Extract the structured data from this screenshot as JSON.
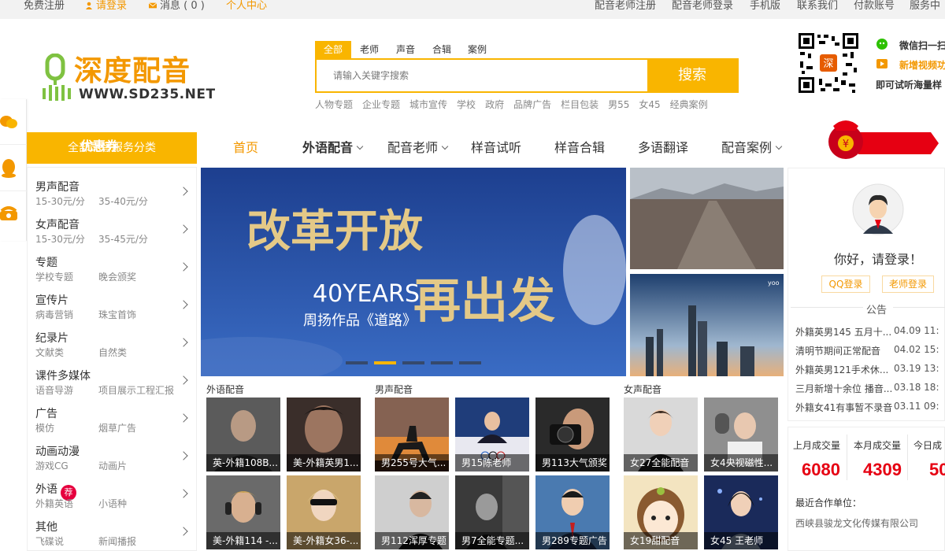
{
  "topbar": {
    "register": "免费注册",
    "login": "请登录",
    "messages": "消息 ( 0 )",
    "personal_center": "个人中心",
    "teacher_register": "配音老师注册",
    "teacher_login": "配音老师登录",
    "mobile": "手机版",
    "contact": "联系我们",
    "payment_account": "付款账号",
    "service": "服务中"
  },
  "logo": {
    "name": "深度配音",
    "url": "WWW.SD235.NET"
  },
  "search": {
    "tabs": [
      "全部",
      "老师",
      "声音",
      "合辑",
      "案例"
    ],
    "placeholder": "请输入关键字搜索",
    "button": "搜索",
    "hotwords": [
      "人物专题",
      "企业专题",
      "城市宣传",
      "学校",
      "政府",
      "品牌广告",
      "栏目包装",
      "男55",
      "女45",
      "经典案例"
    ]
  },
  "promo": {
    "line1": "微信扫一扫",
    "line2": "新增视频功",
    "line3": "即可试听海量样",
    "qr_badge": "深"
  },
  "category_header": "全部配音服务分类",
  "categories": [
    {
      "title": "男声配音",
      "sub1": "15-30元/分",
      "sub2": "35-40元/分"
    },
    {
      "title": "女声配音",
      "sub1": "15-30元/分",
      "sub2": "35-45元/分"
    },
    {
      "title": "专题",
      "sub1": "学校专题",
      "sub2": "晚会颁奖"
    },
    {
      "title": "宣传片",
      "sub1": "病毒营销",
      "sub2": "珠宝首饰"
    },
    {
      "title": "纪录片",
      "sub1": "文献类",
      "sub2": "自然类"
    },
    {
      "title": "课件多媒体",
      "sub1": "语音导游",
      "sub2": "项目展示工程汇报"
    },
    {
      "title": "广告",
      "sub1": "模仿",
      "sub2": "烟草广告"
    },
    {
      "title": "动画动漫",
      "sub1": "游戏CG",
      "sub2": "动画片"
    },
    {
      "title": "外语",
      "sub1": "外籍英语",
      "sub2": "小语种",
      "badge": "荐"
    },
    {
      "title": "其他",
      "sub1": "飞碟说",
      "sub2": "新闻播报"
    }
  ],
  "nav": [
    "首页",
    "外语配音",
    "配音老师",
    "样音试听",
    "样音合辑",
    "多语翻译",
    "配音案例"
  ],
  "coupon": {
    "label": "优惠券",
    "symbol": "¥"
  },
  "banner": {
    "title_line1": "改革开放",
    "years": "40YEARS",
    "title_line2": "再出发",
    "subtitle": "周扬作品《道路》"
  },
  "thumb_logo": "yoo",
  "login_panel": {
    "greeting": "你好，请登录！",
    "qq_login": "QQ登录",
    "teacher_login": "老师登录",
    "notice_title": "公告",
    "notices": [
      {
        "text": "外籍英男145 五月十...",
        "date": "04.09 11:"
      },
      {
        "text": "清明节期间正常配音",
        "date": "04.02 15:"
      },
      {
        "text": "外籍英男121手术休...",
        "date": "03.19 13:"
      },
      {
        "text": "三月新增十余位 播音...",
        "date": "03.18 18:"
      },
      {
        "text": "外籍女41有事暂不录音",
        "date": "03.11 09:"
      }
    ]
  },
  "stats": {
    "last_month_label": "上月成交量",
    "last_month_value": "6080",
    "this_month_label": "本月成交量",
    "this_month_value": "4309",
    "today_label": "今日成",
    "today_value": "50",
    "partner_label": "最近合作单位：",
    "partner_name": "西峡县骏龙文化传媒有限公司"
  },
  "sections": {
    "foreign": "外语配音",
    "male": "男声配音",
    "female": "女声配音"
  },
  "cards": [
    {
      "caption": "英-外籍108B...",
      "bg": "#5b5b5b"
    },
    {
      "caption": "美-外籍英男1...",
      "bg": "#3a2e2a"
    },
    {
      "caption": "男255号大气...",
      "bg": "#8a5a2a"
    },
    {
      "caption": "男15陈老师",
      "bg": "#1f3d7a"
    },
    {
      "caption": "男113大气颁奖",
      "bg": "#2a2a2a"
    },
    {
      "caption": "女27全能配音",
      "bg": "#d9d9d9"
    },
    {
      "caption": "女4央视磁性...",
      "bg": "#8f8f8f"
    },
    {
      "caption": "美-外籍114 -...",
      "bg": "#6a6a6a"
    },
    {
      "caption": "美-外籍女36-...",
      "bg": "#c9a66b"
    },
    {
      "caption": "男112浑厚专题",
      "bg": "#cfcfcf"
    },
    {
      "caption": "男7全能专题...",
      "bg": "#3a3a3a"
    },
    {
      "caption": "男289专题广告",
      "bg": "#4a7ab0"
    },
    {
      "caption": "女19甜配音",
      "bg": "#f3e4c0"
    },
    {
      "caption": "女45 王老师",
      "bg": "#1a2a5a"
    }
  ]
}
